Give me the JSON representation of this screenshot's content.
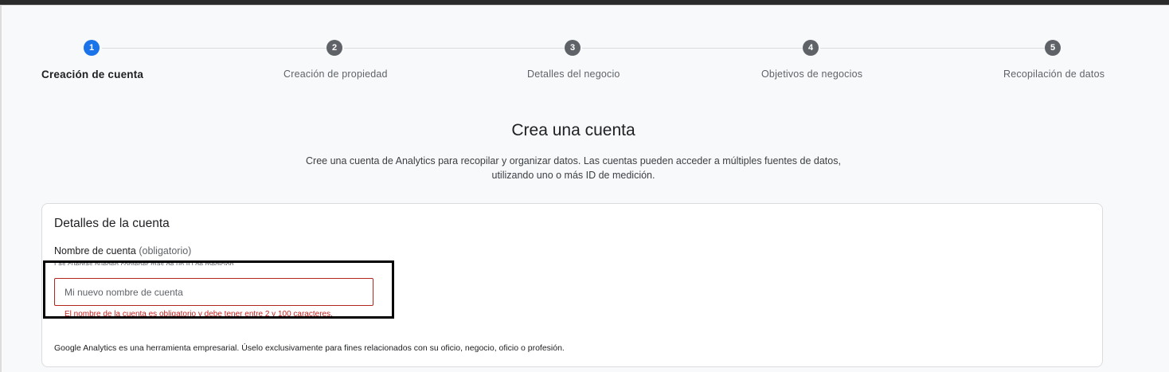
{
  "stepper": {
    "steps": [
      {
        "number": "1",
        "label": "Creación de cuenta",
        "active": true
      },
      {
        "number": "2",
        "label": "Creación de propiedad",
        "active": false
      },
      {
        "number": "3",
        "label": "Detalles del negocio",
        "active": false
      },
      {
        "number": "4",
        "label": "Objetivos de negocios",
        "active": false
      },
      {
        "number": "5",
        "label": "Recopilación de datos",
        "active": false
      }
    ]
  },
  "main": {
    "title": "Crea una cuenta",
    "subtitle": "Cree una cuenta de Analytics para recopilar y organizar datos. Las cuentas pueden acceder a múltiples fuentes de datos, utilizando uno o más ID de medición."
  },
  "card": {
    "title": "Detalles de la cuenta",
    "field_label": "Nombre de cuenta",
    "field_required": "(obligatorio)",
    "field_hint": "Las cuentas pueden contener más de un ID de medición.",
    "input_placeholder": "Mi nuevo nombre de cuenta",
    "input_value": "",
    "error": "El nombre de la cuenta es obligatorio y debe tener entre 2 y 100 caracteres.",
    "disclaimer": "Google Analytics es una herramienta empresarial. Úselo exclusivamente para fines relacionados con su oficio, negocio, oficio o profesión."
  },
  "colors": {
    "active_step": "#1a73e8",
    "inactive_step": "#5f6368",
    "error": "#c5221f"
  }
}
